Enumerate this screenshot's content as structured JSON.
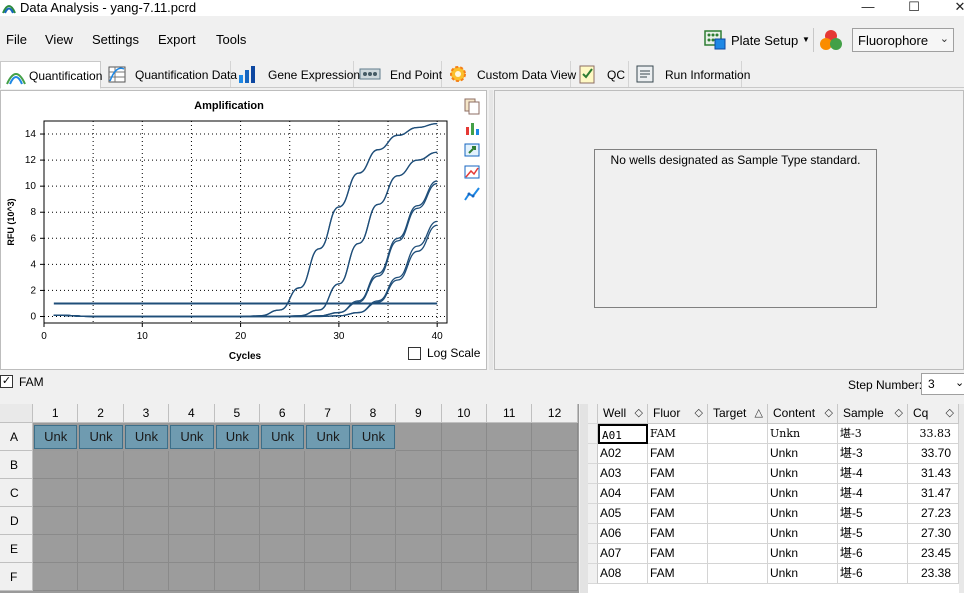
{
  "window": {
    "title": "Data Analysis - yang-7.11.pcrd",
    "minimize": "—",
    "maximize": "☐",
    "close": "✕"
  },
  "menu": {
    "items": [
      "File",
      "View",
      "Settings",
      "Export",
      "Tools"
    ],
    "plate_setup": "Plate Setup",
    "fluorophore": "Fluorophore"
  },
  "tabs": [
    {
      "label": "Quantification",
      "icon": "amplification-icon",
      "active": true
    },
    {
      "label": "Quantification Data",
      "icon": "data-table-icon",
      "active": false
    },
    {
      "label": "Gene Expression",
      "icon": "bar-chart-icon",
      "active": false
    },
    {
      "label": "End Point",
      "icon": "end-point-icon",
      "active": false
    },
    {
      "label": "Custom Data View",
      "icon": "gear-icon",
      "active": false
    },
    {
      "label": "QC",
      "icon": "checklist-icon",
      "active": false
    },
    {
      "label": "Run Information",
      "icon": "run-info-icon",
      "active": false
    }
  ],
  "chart_data": {
    "type": "line",
    "title": "Amplification",
    "xlabel": "Cycles",
    "ylabel": "RFU (10^3)",
    "xlim": [
      0,
      41
    ],
    "ylim": [
      -0.5,
      15
    ],
    "x_ticks": [
      0,
      10,
      20,
      30,
      40
    ],
    "y_ticks": [
      0,
      2,
      4,
      6,
      8,
      10,
      12,
      14
    ],
    "grid": true,
    "colors": {
      "series": "#1f4e79",
      "threshold": "#1f4e79"
    },
    "threshold": 1.0,
    "x": [
      1,
      5,
      10,
      15,
      20,
      22,
      24,
      26,
      28,
      30,
      32,
      34,
      36,
      38,
      40
    ],
    "series": [
      {
        "values": [
          0.1,
          0.0,
          0.0,
          0.0,
          0.0,
          0.05,
          0.5,
          2.2,
          5.2,
          8.4,
          11.0,
          12.8,
          13.9,
          14.5,
          14.8
        ]
      },
      {
        "values": [
          0.1,
          0.0,
          0.0,
          0.0,
          0.0,
          0.05,
          0.5,
          2.2,
          5.2,
          8.4,
          11.0,
          12.8,
          13.9,
          14.5,
          14.8
        ]
      },
      {
        "values": [
          0.1,
          0.0,
          0.0,
          0.0,
          0.0,
          0.0,
          0.0,
          0.05,
          0.5,
          2.5,
          5.6,
          8.6,
          10.8,
          12.0,
          12.6
        ]
      },
      {
        "values": [
          0.1,
          0.0,
          0.0,
          0.0,
          0.0,
          0.0,
          0.0,
          0.05,
          0.5,
          2.5,
          5.6,
          8.6,
          10.8,
          12.0,
          12.6
        ]
      },
      {
        "values": [
          0.1,
          0.0,
          0.0,
          0.0,
          0.0,
          0.0,
          0.0,
          0.0,
          0.05,
          0.3,
          1.2,
          3.3,
          6.0,
          8.5,
          10.4
        ]
      },
      {
        "values": [
          0.1,
          0.0,
          0.0,
          0.0,
          0.0,
          0.0,
          0.0,
          0.0,
          0.05,
          0.3,
          1.1,
          3.1,
          5.8,
          8.3,
          10.2
        ]
      },
      {
        "values": [
          0.1,
          0.0,
          0.0,
          0.0,
          0.0,
          0.0,
          0.0,
          0.0,
          0.0,
          0.05,
          0.3,
          1.2,
          3.0,
          5.4,
          7.3
        ]
      },
      {
        "values": [
          0.1,
          0.0,
          0.0,
          0.0,
          0.0,
          0.0,
          0.0,
          0.0,
          0.0,
          0.05,
          0.3,
          1.1,
          2.8,
          5.0,
          7.0
        ]
      }
    ]
  },
  "log_scale": {
    "label": "Log Scale",
    "checked": false
  },
  "std_panel": {
    "message": "No wells designated as Sample Type standard."
  },
  "fluor_filter": {
    "label": "FAM",
    "checked": true,
    "check_mark": "✓"
  },
  "step": {
    "label": "Step Number:",
    "value": "3",
    "chevron": "⌄"
  },
  "plate": {
    "columns": [
      "1",
      "2",
      "3",
      "4",
      "5",
      "6",
      "7",
      "8",
      "9",
      "10",
      "11",
      "12"
    ],
    "rows": [
      "A",
      "B",
      "C",
      "D",
      "E",
      "F"
    ],
    "filled": {
      "row": "A",
      "cols": [
        1,
        2,
        3,
        4,
        5,
        6,
        7,
        8
      ],
      "label": "Unk"
    },
    "colors": {
      "filled": "#6f9bb0",
      "empty": "#9c9c9c"
    }
  },
  "results": {
    "headers": [
      "Well",
      "Fluor",
      "Target",
      "Content",
      "Sample",
      "Cq"
    ],
    "sort_glyph": "◇",
    "target_sort_glyph": "△",
    "rows": [
      [
        "A01",
        "FAM",
        "",
        "Unkn",
        "堪-3",
        "33.83"
      ],
      [
        "A02",
        "FAM",
        "",
        "Unkn",
        "堪-3",
        "33.70"
      ],
      [
        "A03",
        "FAM",
        "",
        "Unkn",
        "堪-4",
        "31.43"
      ],
      [
        "A04",
        "FAM",
        "",
        "Unkn",
        "堪-4",
        "31.47"
      ],
      [
        "A05",
        "FAM",
        "",
        "Unkn",
        "堪-5",
        "27.23"
      ],
      [
        "A06",
        "FAM",
        "",
        "Unkn",
        "堪-5",
        "27.30"
      ],
      [
        "A07",
        "FAM",
        "",
        "Unkn",
        "堪-6",
        "23.45"
      ],
      [
        "A08",
        "FAM",
        "",
        "Unkn",
        "堪-6",
        "23.38"
      ]
    ]
  }
}
